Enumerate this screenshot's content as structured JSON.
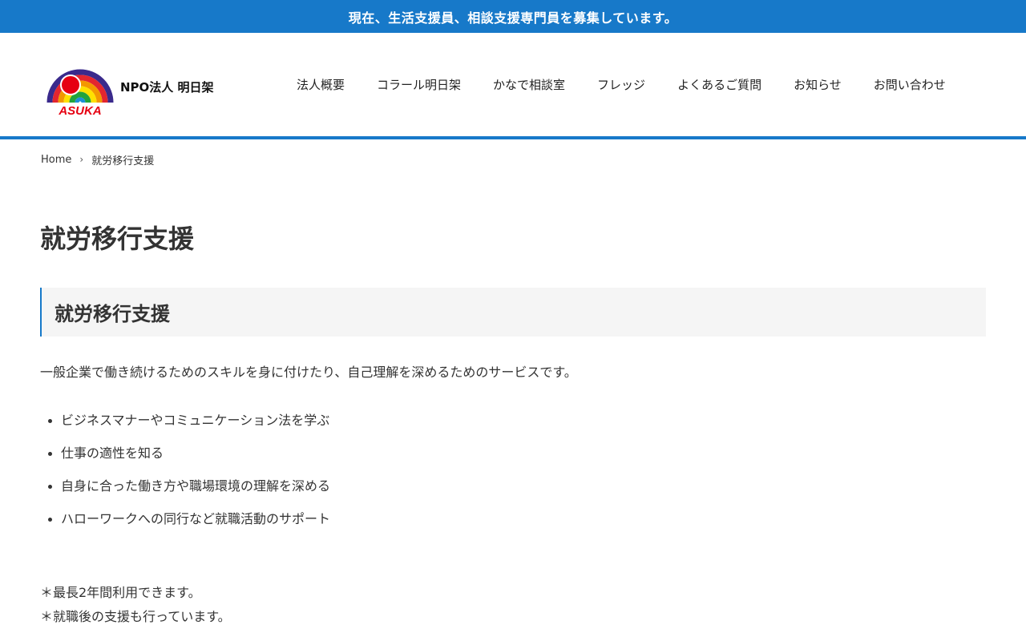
{
  "announcement": "現在、生活支援員、相談支援専門員を募集しています。",
  "colors": {
    "brand_blue": "#1779c9",
    "heading_bg": "#f5f5f5",
    "text": "#333333"
  },
  "header": {
    "logo_text": "ASUKA",
    "site_name": "NPO法人 明日架",
    "nav": [
      {
        "label": "法人概要"
      },
      {
        "label": "コラール明日架"
      },
      {
        "label": "かなで相談室"
      },
      {
        "label": "フレッジ"
      },
      {
        "label": "よくあるご質問"
      },
      {
        "label": "お知らせ"
      },
      {
        "label": "お問い合わせ"
      }
    ]
  },
  "breadcrumb": {
    "home": "Home",
    "separator_icon": "chevron-right-icon",
    "current": "就労移行支援"
  },
  "content": {
    "page_title": "就労移行支援",
    "section_heading": "就労移行支援",
    "intro": "一般企業で働き続けるためのスキルを身に付けたり、自己理解を深めるためのサービスです。",
    "features": [
      "ビジネスマナーやコミュニケーション法を学ぶ",
      "仕事の適性を知る",
      "自身に合った働き方や職場環境の理解を深める",
      "ハローワークへの同行など就職活動のサポート"
    ],
    "notes": [
      "＊最長2年間利用できます。",
      "＊就職後の支援も行っています。"
    ]
  }
}
